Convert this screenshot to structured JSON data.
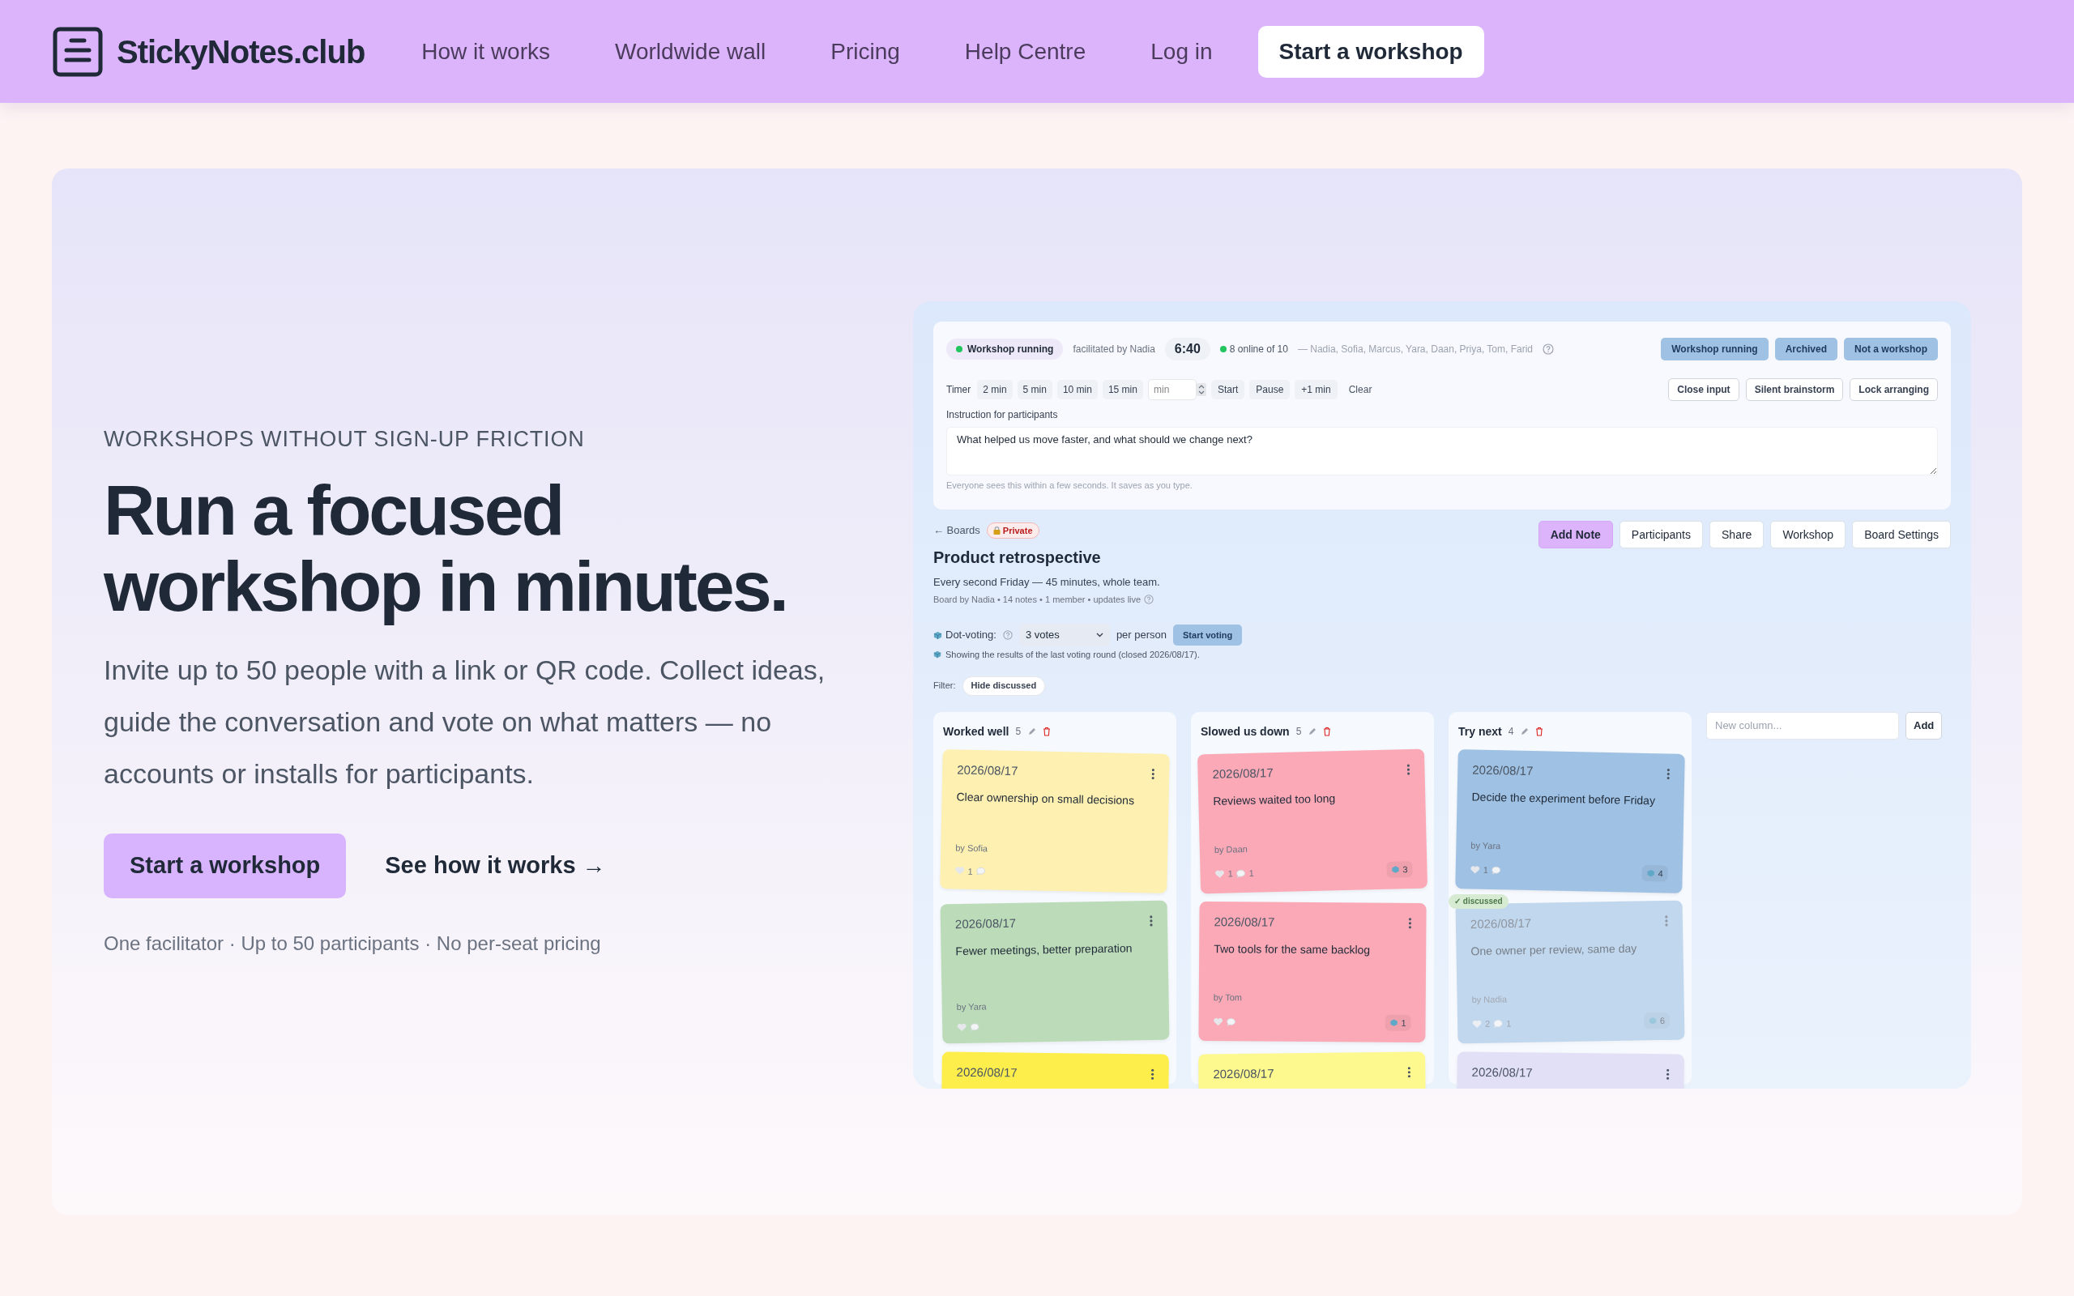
{
  "nav": {
    "logo_text": "StickyNotes.club",
    "links": [
      "How it works",
      "Worldwide wall",
      "Pricing",
      "Help Centre",
      "Log in"
    ],
    "cta": "Start a workshop"
  },
  "hero": {
    "eyebrow": "WORKSHOPS WITHOUT SIGN-UP FRICTION",
    "headline": [
      "Run a focused",
      "workshop in minutes."
    ],
    "paragraph": "Invite up to 50 people with a link or QR code. Collect ideas, guide the conversation and vote on what matters — no accounts or installs for participants.",
    "primary_button": "Start a workshop",
    "secondary_link": "See how it works →",
    "footnote": "One facilitator · Up to 50 participants · No per-seat pricing"
  },
  "app": {
    "status": "Workshop running",
    "facilitator": "facilitated by Nadia",
    "timer": "6:40",
    "online": "8 online of 10",
    "participants": "— Nadia, Sofia, Marcus, Yara, Daan, Priya, Tom, Farid",
    "mode_buttons": [
      "Workshop running",
      "Archived",
      "Not a workshop"
    ],
    "timer_label": "Timer",
    "presets": [
      "2 min",
      "5 min",
      "10 min",
      "15 min"
    ],
    "minutes_placeholder": "min",
    "timer_actions": [
      {
        "label": "Start",
        "kind": "chip"
      },
      {
        "label": "Pause",
        "kind": "chip"
      },
      {
        "label": "+1 min",
        "kind": "chip"
      },
      {
        "label": "Clear",
        "kind": "plain"
      }
    ],
    "control_buttons": [
      "Close input",
      "Silent brainstorm",
      "Lock arranging"
    ],
    "instruction_label": "Instruction for participants",
    "instruction_value": "What helped us move faster, and what should we change next?",
    "instruction_hint": "Everyone sees this within a few seconds. It saves as you type."
  },
  "board": {
    "back": "← Boards",
    "privacy": "Private",
    "title": "Product retrospective",
    "description": "Every second Friday — 45 minutes, whole team.",
    "meta": "Board by Nadia • 14 notes • 1 member • updates live",
    "actions": [
      {
        "label": "Add Note",
        "kind": "primary"
      },
      {
        "label": "Participants",
        "kind": "default"
      },
      {
        "label": "Share",
        "kind": "default"
      },
      {
        "label": "Workshop",
        "kind": "default"
      },
      {
        "label": "Board Settings",
        "kind": "default"
      }
    ],
    "voting_label": "Dot-voting:",
    "votes_value": "3 votes",
    "per_person": "per person",
    "start_voting": "Start voting",
    "voting_note": "Showing the results of the last voting round (closed 2026/08/17).",
    "filter_label": "Filter:",
    "filter_chip": "Hide discussed",
    "columns": [
      {
        "title": "Worked well",
        "count": "5",
        "notes": [
          {
            "date": "2026/08/17",
            "text": "Clear ownership on small decisions",
            "author": "by Sofia",
            "likes": "1",
            "color": "#fdf0b0",
            "discussed": false
          },
          {
            "date": "2026/08/17",
            "text": "Fewer meetings, better preparation",
            "author": "by Yara",
            "color": "#bcdcb9",
            "discussed": false
          },
          {
            "date": "2026/08/17",
            "color": "#fdee4c",
            "discussed": false
          }
        ]
      },
      {
        "title": "Slowed us down",
        "count": "5",
        "notes": [
          {
            "date": "2026/08/17",
            "text": "Reviews waited too long",
            "author": "by Daan",
            "likes": "1",
            "comments": "1",
            "votes": "3",
            "color": "#fba9b7",
            "discussed": false
          },
          {
            "date": "2026/08/17",
            "text": "Two tools for the same backlog",
            "author": "by Tom",
            "votes": "1",
            "color": "#fba9b7",
            "discussed": false
          },
          {
            "date": "2026/08/17",
            "color": "#fdf98e",
            "discussed": false
          }
        ]
      },
      {
        "title": "Try next",
        "count": "4",
        "notes": [
          {
            "date": "2026/08/17",
            "text": "Decide the experiment before Friday",
            "author": "by Yara",
            "likes": "1",
            "votes": "4",
            "color": "#9fc1e3",
            "discussed": false
          },
          {
            "date": "2026/08/17",
            "text": "One owner per review, same day",
            "author": "by Nadia",
            "likes": "2",
            "comments": "1",
            "votes": "6",
            "color": "#9fc1e3",
            "discussed": true,
            "badge": "✓ discussed"
          },
          {
            "date": "2026/08/17",
            "color": "#e2e0f6",
            "discussed": false
          }
        ]
      }
    ],
    "new_column_placeholder": "New column...",
    "add_button": "Add"
  }
}
